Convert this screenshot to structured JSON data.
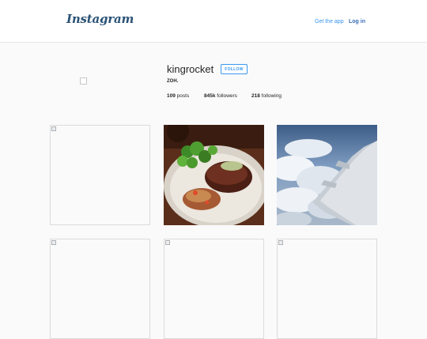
{
  "header": {
    "logo_text": "Instagram",
    "get_app_label": "Get the app",
    "login_label": "Log in"
  },
  "profile": {
    "username": "kingrocket",
    "follow_label": "FOLLOW",
    "full_name": "ZOH.",
    "posts_count": "109",
    "posts_label": "posts",
    "followers_count": "845k",
    "followers_label": "followers",
    "following_count": "218",
    "following_label": "following"
  },
  "colors": {
    "accent": "#3897f0",
    "logo": "#2a5276",
    "background": "#fafafa"
  },
  "grid": [
    {
      "type": "broken-image"
    },
    {
      "type": "photo",
      "subject": "steak-with-broccoli"
    },
    {
      "type": "photo",
      "subject": "airplane-wing-over-clouds"
    },
    {
      "type": "broken-image"
    },
    {
      "type": "broken-image"
    },
    {
      "type": "broken-image"
    }
  ]
}
